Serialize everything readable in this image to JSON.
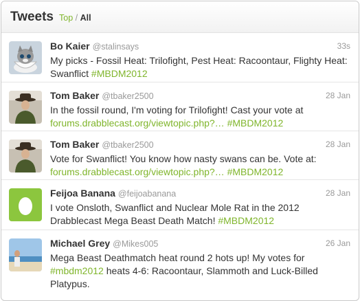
{
  "header": {
    "title": "Tweets",
    "filter_top": "Top",
    "filter_sep": "/",
    "filter_all": "All"
  },
  "colors": {
    "accent": "#7fb52b",
    "text": "#333333",
    "muted": "#999999"
  },
  "tweets": [
    {
      "name": "Bo Kaier",
      "handle": "@stalinsays",
      "time": "33s",
      "avatar_icon": "kitten-in-teacup",
      "text_1": "My picks - Fossil Heat: Trilofight, Pest Heat: Racoontaur, Flighty Heat: Swanflict ",
      "hashtag_1": "#MBDM2012"
    },
    {
      "name": "Tom Baker",
      "handle": "@tbaker2500",
      "time": "28 Jan",
      "avatar_icon": "man-in-hat",
      "text_1": "In the fossil round, I'm voting for Trilofight! Cast your vote at ",
      "link_1": "forums.drabblecast.org/viewtopic.php?…",
      "hashtag_1": "#MBDM2012"
    },
    {
      "name": "Tom Baker",
      "handle": "@tbaker2500",
      "time": "28 Jan",
      "avatar_icon": "man-in-hat",
      "text_1": "Vote for Swanflict! You know how nasty swans can be. Vote at: ",
      "link_1": "forums.drabblecast.org/viewtopic.php?…",
      "hashtag_1": "#MBDM2012"
    },
    {
      "name": "Feijoa Banana",
      "handle": "@feijoabanana",
      "time": "28 Jan",
      "avatar_icon": "default-egg",
      "text_1": "I vote Onsloth, Swanflict and Nuclear Mole Rat in the 2012 Drabblecast Mega Beast Death Match! ",
      "hashtag_1": "#MBDM2012"
    },
    {
      "name": "Michael Grey",
      "handle": "@Mikes005",
      "time": "26 Jan",
      "avatar_icon": "beach-photo",
      "text_1": "Mega Beast Deathmatch heat round 2 hots up! My votes for ",
      "hashtag_1": "#mbdm2012",
      "text_2": " heats 4-6: Racoontaur, Slammoth and Luck-Billed Platypus."
    }
  ]
}
